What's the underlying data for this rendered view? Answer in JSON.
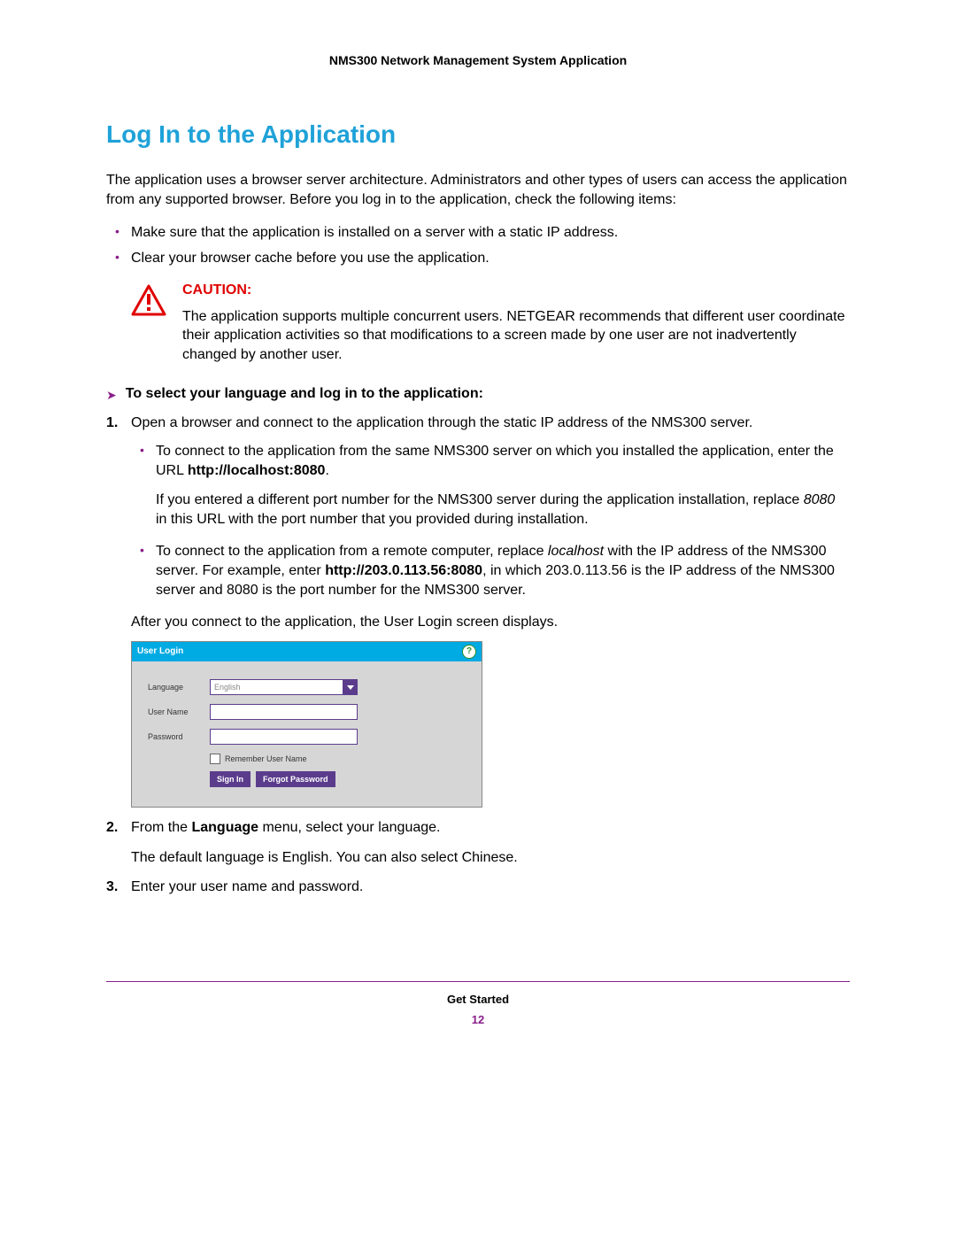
{
  "doc_header": "NMS300 Network Management System Application",
  "section_title": "Log In to the Application",
  "intro": "The application uses a browser server architecture. Administrators and other types of users can access the application from any supported browser. Before you log in to the application, check the following items:",
  "intro_bullets": [
    "Make sure that the application is installed on a server with a static IP address.",
    "Clear your browser cache before you use the application."
  ],
  "caution": {
    "label": "CAUTION:",
    "text": "The application supports multiple concurrent users. NETGEAR recommends that different user coordinate their application activities so that modifications to a screen made by one user are not inadvertently changed by another user."
  },
  "procedure_title": "To select your language and log in to the application:",
  "step1": {
    "num": "1.",
    "text_a": "Open a browser and connect to the application through the static IP address of the NMS300 server.",
    "sb1_a": "To connect to the application from the same NMS300 server on which you installed the application, enter the URL ",
    "sb1_bold": "http://localhost:8080",
    "sb1_b": ".",
    "sb1_p2_a": "If you entered a different port number for the NMS300 server during the application installation, replace ",
    "sb1_p2_i": "8080",
    "sb1_p2_b": " in this URL with the port number that you provided during installation.",
    "sb2_a": "To connect to the application from a remote computer, replace ",
    "sb2_i": "localhost",
    "sb2_b": " with the IP address of the NMS300 server. For example, enter ",
    "sb2_bold": "http://203.0.113.56:8080",
    "sb2_c": ", in which 203.0.113.56 is the IP address of the NMS300 server and 8080 is the port number for the NMS300 server.",
    "after": "After you connect to the application, the User Login screen displays."
  },
  "login_dialog": {
    "title": "User Login",
    "help": "?",
    "language_label": "Language",
    "language_value": "English",
    "username_label": "User Name",
    "password_label": "Password",
    "remember": "Remember User Name",
    "signin": "Sign In",
    "forgot": "Forgot Password"
  },
  "step2": {
    "num": "2.",
    "text_a": "From the ",
    "text_bold": "Language",
    "text_b": " menu, select your language.",
    "note": "The default language is English. You can also select Chinese."
  },
  "step3": {
    "num": "3.",
    "text": "Enter your user name and password."
  },
  "footer": {
    "chapter": "Get Started",
    "page": "12"
  }
}
